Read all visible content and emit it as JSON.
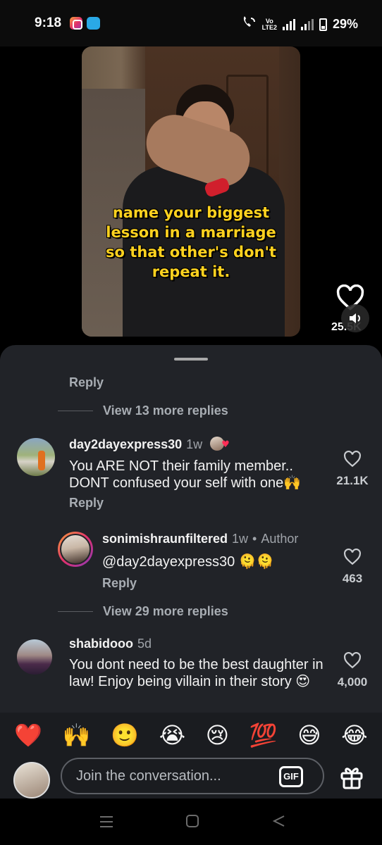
{
  "status_bar": {
    "time": "9:18",
    "volte": [
      "Vo",
      "LTE2"
    ],
    "battery": "29%"
  },
  "video": {
    "caption": [
      "name your biggest",
      "lesson in a marriage",
      "so that other's don't",
      "repeat it."
    ],
    "like_count": "25.5K"
  },
  "thread": {
    "reply_label": "Reply",
    "view_more_1": "View 13 more replies",
    "view_more_2": "View 29 more replies"
  },
  "comments": [
    {
      "username": "day2dayexpress30",
      "age": "1w",
      "text": "You ARE NOT their family member.. DONT confused your self with one🙌",
      "likes": "21.1K",
      "reply_label": "Reply"
    },
    {
      "username": "sonimishraunfiltered",
      "age": "1w",
      "author_tag": "Author",
      "text": "@day2dayexpress30 🫠🫠",
      "likes": "463",
      "reply_label": "Reply"
    },
    {
      "username": "shabidooo",
      "age": "5d",
      "text": "You dont need to be the best daughter in law! Enjoy being villain in their story 😍",
      "likes": "4,000"
    }
  ],
  "emoji_bar": [
    "❤️",
    "🙌",
    "🙂",
    "😭",
    "😢",
    "💯",
    "😅",
    "😂"
  ],
  "composer": {
    "placeholder": "Join the conversation...",
    "gif_label": "GIF"
  }
}
